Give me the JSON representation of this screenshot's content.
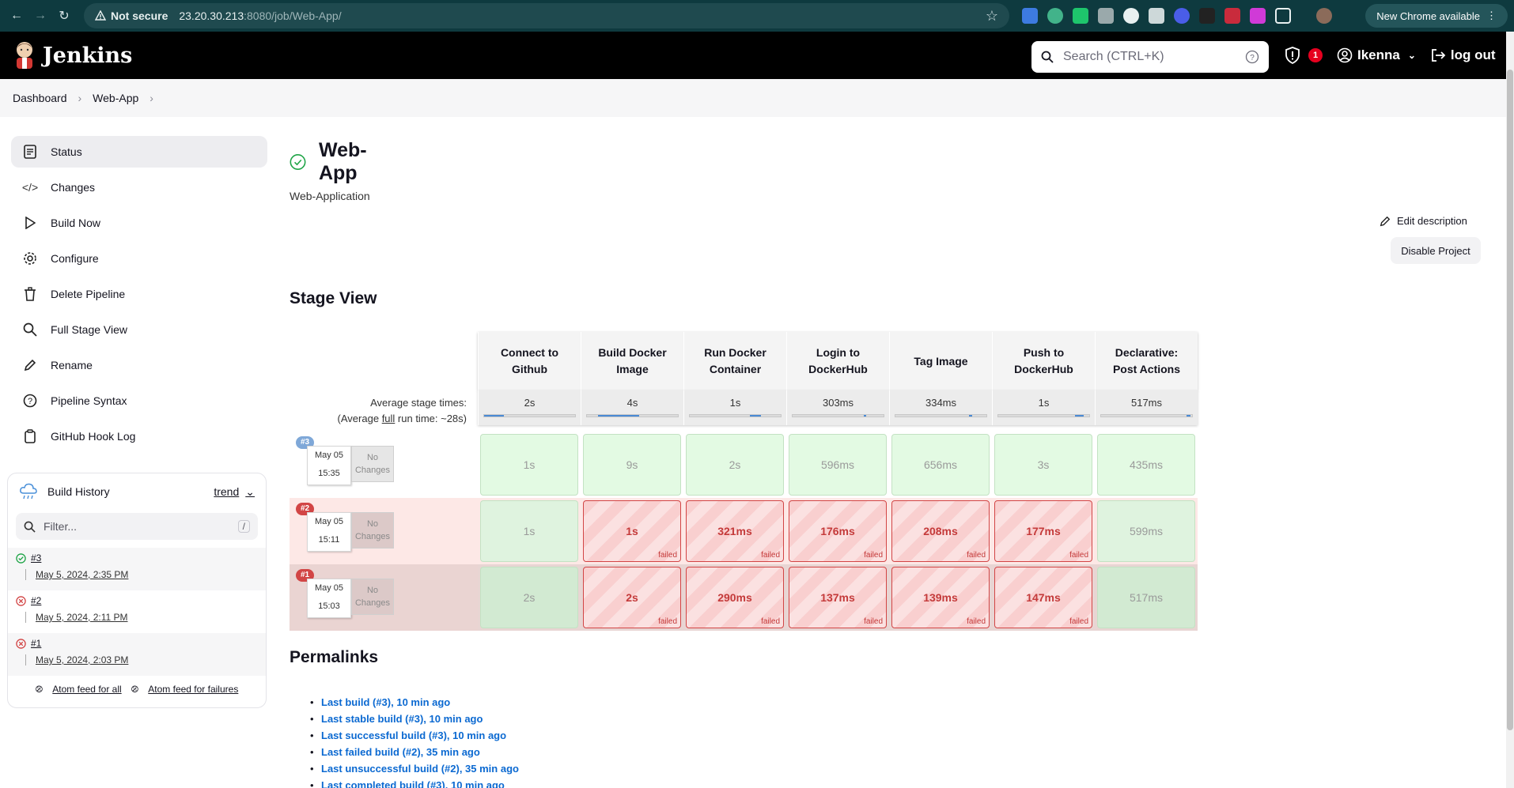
{
  "browser": {
    "security_label": "Not secure",
    "url_host": "23.20.30.213",
    "url_rest": ":8080/job/Web-App/",
    "new_chrome_label": "New Chrome available"
  },
  "header": {
    "logo_text": "Jenkins",
    "search_placeholder": "Search (CTRL+K)",
    "security_count": "1",
    "user_name": "Ikenna",
    "logout_label": "log out"
  },
  "breadcrumb": {
    "items": [
      "Dashboard",
      "Web-App"
    ]
  },
  "sidebar": {
    "items": [
      {
        "label": "Status",
        "icon": "status-icon"
      },
      {
        "label": "Changes",
        "icon": "code-icon"
      },
      {
        "label": "Build Now",
        "icon": "play-icon"
      },
      {
        "label": "Configure",
        "icon": "gear-icon"
      },
      {
        "label": "Delete Pipeline",
        "icon": "trash-icon"
      },
      {
        "label": "Full Stage View",
        "icon": "search-icon"
      },
      {
        "label": "Rename",
        "icon": "pencil-icon"
      },
      {
        "label": "Pipeline Syntax",
        "icon": "help-icon"
      },
      {
        "label": "GitHub Hook Log",
        "icon": "clipboard-icon"
      }
    ]
  },
  "build_history": {
    "title": "Build History",
    "trend_label": "trend",
    "filter_placeholder": "Filter...",
    "filter_shortcut": "/",
    "builds": [
      {
        "number": "#3",
        "date": "May 5, 2024, 2:35 PM",
        "status": "success"
      },
      {
        "number": "#2",
        "date": "May 5, 2024, 2:11 PM",
        "status": "failed"
      },
      {
        "number": "#1",
        "date": "May 5, 2024, 2:03 PM",
        "status": "failed"
      }
    ],
    "feed_all": "Atom feed for all",
    "feed_failures": "Atom feed for failures"
  },
  "main": {
    "title": "Web-App",
    "description": "Web-Application",
    "edit_description": "Edit description",
    "disable_project": "Disable Project",
    "stage_view_title": "Stage View",
    "permalinks_title": "Permalinks"
  },
  "stage_view": {
    "avg_label_line1": "Average stage times:",
    "avg_label_prefix": "(Average ",
    "avg_label_full": "full",
    "avg_label_suffix": " run time: ~28s)",
    "no_changes": "No Changes",
    "stages": [
      {
        "name": "Connect to Github",
        "avg": "2s",
        "bar_fill": 0.22,
        "bar_offset": 0.0
      },
      {
        "name": "Build Docker Image",
        "avg": "4s",
        "bar_fill": 0.45,
        "bar_offset": 0.12
      },
      {
        "name": "Run Docker Container",
        "avg": "1s",
        "bar_fill": 0.12,
        "bar_offset": 0.66
      },
      {
        "name": "Login to DockerHub",
        "avg": "303ms",
        "bar_fill": 0.03,
        "bar_offset": 0.78
      },
      {
        "name": "Tag Image",
        "avg": "334ms",
        "bar_fill": 0.03,
        "bar_offset": 0.81
      },
      {
        "name": "Push to DockerHub",
        "avg": "1s",
        "bar_fill": 0.1,
        "bar_offset": 0.84
      },
      {
        "name": "Declarative: Post Actions",
        "avg": "517ms",
        "bar_fill": 0.04,
        "bar_offset": 0.94
      }
    ],
    "runs": [
      {
        "badge": "#3",
        "date": "May 05",
        "time": "15:35",
        "status": "ok",
        "cells": [
          {
            "v": "1s",
            "s": "ok"
          },
          {
            "v": "9s",
            "s": "ok"
          },
          {
            "v": "2s",
            "s": "ok"
          },
          {
            "v": "596ms",
            "s": "ok"
          },
          {
            "v": "656ms",
            "s": "ok"
          },
          {
            "v": "3s",
            "s": "ok"
          },
          {
            "v": "435ms",
            "s": "ok"
          }
        ]
      },
      {
        "badge": "#2",
        "date": "May 05",
        "time": "15:11",
        "status": "bad",
        "cells": [
          {
            "v": "1s",
            "s": "ok"
          },
          {
            "v": "1s",
            "s": "fail"
          },
          {
            "v": "321ms",
            "s": "fail"
          },
          {
            "v": "176ms",
            "s": "fail"
          },
          {
            "v": "208ms",
            "s": "fail"
          },
          {
            "v": "177ms",
            "s": "fail"
          },
          {
            "v": "599ms",
            "s": "ok"
          }
        ]
      },
      {
        "badge": "#1",
        "date": "May 05",
        "time": "15:03",
        "status": "bad",
        "cells": [
          {
            "v": "2s",
            "s": "ok"
          },
          {
            "v": "2s",
            "s": "fail"
          },
          {
            "v": "290ms",
            "s": "fail"
          },
          {
            "v": "137ms",
            "s": "fail"
          },
          {
            "v": "139ms",
            "s": "fail"
          },
          {
            "v": "147ms",
            "s": "fail"
          },
          {
            "v": "517ms",
            "s": "ok"
          }
        ]
      }
    ],
    "failed_label": "failed"
  },
  "permalinks": [
    "Last build (#3), 10 min ago",
    "Last stable build (#3), 10 min ago",
    "Last successful build (#3), 10 min ago",
    "Last failed build (#2), 35 min ago",
    "Last unsuccessful build (#2), 35 min ago",
    "Last completed build (#3), 10 min ago"
  ]
}
